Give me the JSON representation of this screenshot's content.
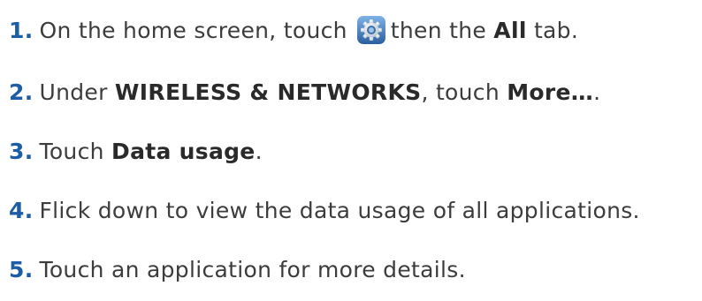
{
  "steps": [
    {
      "number": "1.",
      "parts": [
        "On the home screen, touch",
        "then the",
        "All",
        "tab."
      ],
      "icon": "settings-gear-icon"
    },
    {
      "number": "2.",
      "parts": [
        "Under",
        "WIRELESS & NETWORKS",
        ", touch",
        "More…",
        "."
      ]
    },
    {
      "number": "3.",
      "parts": [
        "Touch",
        "Data usage",
        "."
      ]
    },
    {
      "number": "4.",
      "parts": [
        "Flick down to view the data usage of all applications."
      ]
    },
    {
      "number": "5.",
      "parts": [
        "Touch an application for more details."
      ]
    }
  ],
  "colors": {
    "step_number": "#1c5da6",
    "body_text": "#3c3c3c",
    "bold_text": "#2a2a2a",
    "icon_blue": "#2f6fb5"
  }
}
